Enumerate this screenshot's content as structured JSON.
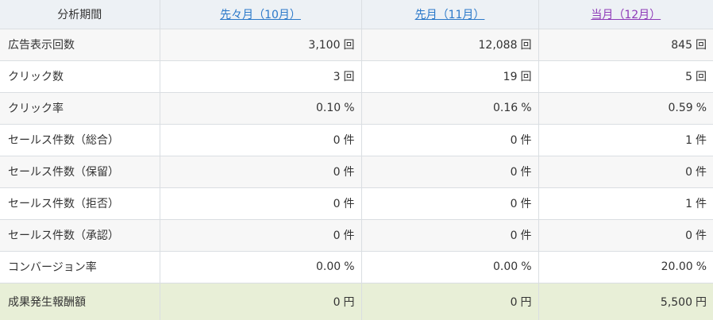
{
  "header": {
    "period_label": "分析期間",
    "columns": [
      {
        "label": "先々月（10月）",
        "kind": "prev"
      },
      {
        "label": "先月（11月）",
        "kind": "prev"
      },
      {
        "label": "当月（12月）",
        "kind": "current"
      }
    ]
  },
  "rows": [
    {
      "label": "広告表示回数",
      "unit": "回",
      "values": [
        "3,100",
        "12,088",
        "845"
      ]
    },
    {
      "label": "クリック数",
      "unit": "回",
      "values": [
        "3",
        "19",
        "5"
      ]
    },
    {
      "label": "クリック率",
      "unit": "%",
      "values": [
        "0.10",
        "0.16",
        "0.59"
      ]
    },
    {
      "label": "セールス件数（総合）",
      "unit": "件",
      "values": [
        "0",
        "0",
        "1"
      ]
    },
    {
      "label": "セールス件数（保留）",
      "unit": "件",
      "values": [
        "0",
        "0",
        "0"
      ]
    },
    {
      "label": "セールス件数（拒否）",
      "unit": "件",
      "values": [
        "0",
        "0",
        "1"
      ]
    },
    {
      "label": "セールス件数（承認）",
      "unit": "件",
      "values": [
        "0",
        "0",
        "0"
      ]
    },
    {
      "label": "コンバージョン率",
      "unit": "%",
      "values": [
        "0.00",
        "0.00",
        "20.00"
      ]
    },
    {
      "label": "成果発生報酬額",
      "unit": "円",
      "values": [
        "0",
        "0",
        "5,500"
      ],
      "total": true
    }
  ],
  "colors": {
    "header_bg": "#edf1f5",
    "link_prev": "#2a78c9",
    "link_current": "#8e3ab8",
    "total_row_bg": "#e8efd7"
  }
}
